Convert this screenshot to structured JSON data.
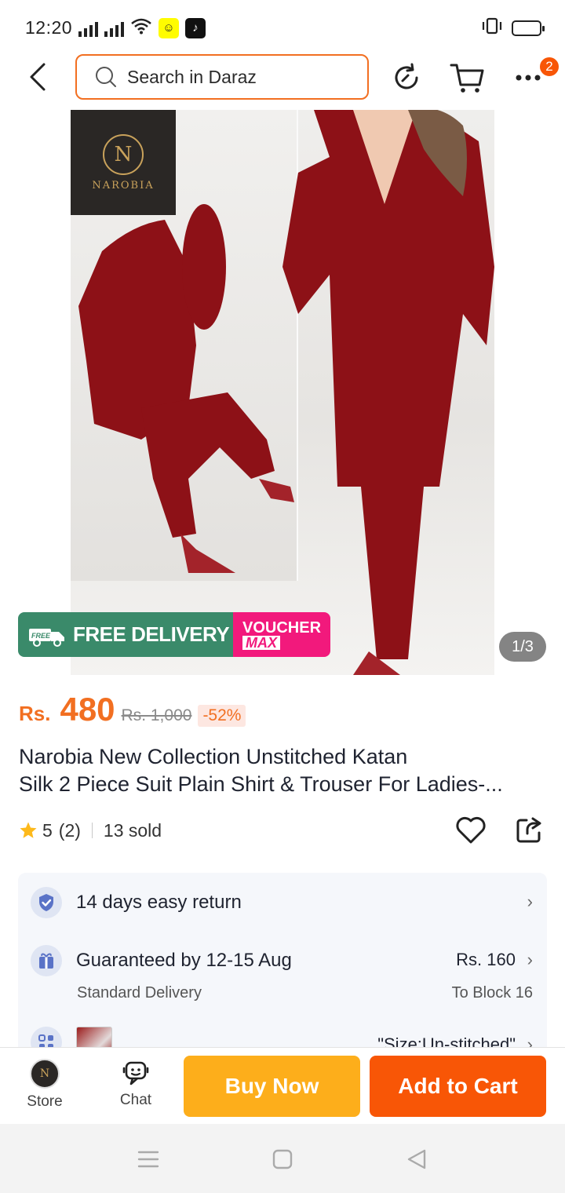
{
  "status_bar": {
    "time": "12:20",
    "notification_badge": "2"
  },
  "header": {
    "search_placeholder": "Search in Daraz",
    "cart_count": "2"
  },
  "product_image": {
    "brand_logo_text": "NAROBIA",
    "promo_free_delivery": "FREE DELIVERY",
    "promo_free_tag": "FREE",
    "promo_voucher": "VOUCHER",
    "promo_max": "MAX",
    "pager": "1/3"
  },
  "price": {
    "currency": "Rs.",
    "current": "480",
    "original": "Rs. 1,000",
    "discount": "-52%"
  },
  "title": {
    "line1": "Narobia New Collection Unstitched Katan",
    "line2": "Silk 2 Piece Suit Plain Shirt & Trouser For Ladies-..."
  },
  "rating": {
    "stars": "5",
    "count": "(2)",
    "sold": "13 sold"
  },
  "services": {
    "return": "14 days easy return",
    "delivery_main": "Guaranteed by 12-15 Aug",
    "delivery_sub": "Standard Delivery",
    "delivery_price": "Rs. 160",
    "delivery_location": "To Block 16",
    "variant": "\"Size:Un-stitched\""
  },
  "action_bar": {
    "store_label": "Store",
    "chat_label": "Chat",
    "buy_now": "Buy Now",
    "add_to_cart": "Add to Cart"
  },
  "colors": {
    "accent": "#f26f21",
    "buy_now": "#fdae1b",
    "add_to_cart": "#f85606",
    "free_delivery": "#3a8a6a",
    "voucher": "#f2197c"
  }
}
